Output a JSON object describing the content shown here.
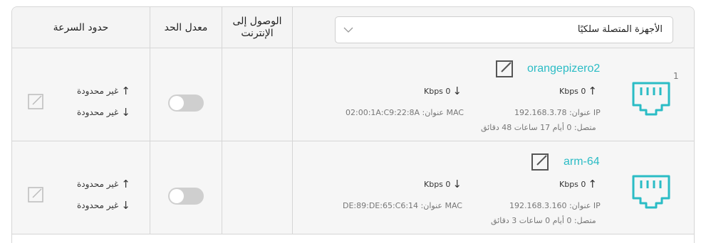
{
  "header": {
    "device_filter": {
      "selected": "الأجهزة المتصلة سلكيًا"
    },
    "col_internet": "الوصول إلى الإنترنت",
    "col_rate_limit": "معدل الحد",
    "col_speed_limits": "حدود السرعة"
  },
  "devices": [
    {
      "index": "1",
      "name": "orangepizero2",
      "upload_rate": "Kbps 0",
      "download_rate": "Kbps 0",
      "ip": "IP عنوان: 192.168.3.78",
      "mac": "MAC عنوان: 02:00:1A:C9:22:8A",
      "connected": "متصل: 0 أيام 17 ساعات 48 دقائق",
      "upload_limit": "غير محدودة",
      "download_limit": "غير محدودة",
      "rate_limit_enabled": false
    },
    {
      "index": "",
      "name": "arm-64",
      "upload_rate": "Kbps 0",
      "download_rate": "Kbps 0",
      "ip": "IP عنوان: 192.168.3.160",
      "mac": "MAC عنوان: DE:89:DE:65:C6:14",
      "connected": "متصل: 0 أيام 0 ساعات 3 دقائق",
      "upload_limit": "غير محدودة",
      "download_limit": "غير محدودة",
      "rate_limit_enabled": false
    }
  ],
  "colors": {
    "accent": "#2bbcc5",
    "toggle_off": "#cfcfcf"
  }
}
